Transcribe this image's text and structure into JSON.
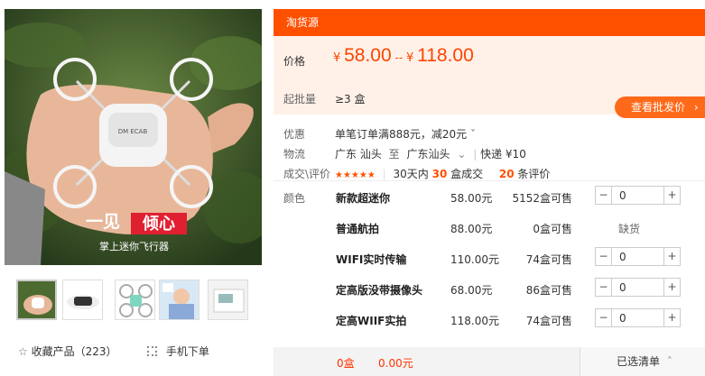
{
  "gallery": {
    "overlay_title_a": "一见",
    "overlay_title_b": "倾心",
    "overlay_subtitle": "掌上迷你飞行器",
    "drone_label": "DM ECAB"
  },
  "favorite": {
    "icon": "star-outline-icon",
    "label": "收藏产品（223）"
  },
  "mobile_order": {
    "icon": "qr-code-icon",
    "label": "手机下单"
  },
  "source_bar": {
    "label": "淘货源"
  },
  "price": {
    "label": "价格",
    "currency": "¥",
    "min": "58.00",
    "sep": "--",
    "max": "118.00"
  },
  "moq": {
    "label": "起批量",
    "value": "≥3 盒"
  },
  "wholesale_button": {
    "label": "查看批发价",
    "chevron": "›"
  },
  "promo": {
    "label": "优惠",
    "value": "单笔订单满888元，减20元",
    "chevron": "ˇ"
  },
  "logistics": {
    "label": "物流",
    "from": "广东 汕头",
    "to_word": "至",
    "to": "广东汕头",
    "chevron": "⌄",
    "separator": "|",
    "express": "快递 ¥10"
  },
  "reviews": {
    "label": "成交\\评价",
    "stars": "★★★★★",
    "rating": 4.5,
    "sales_prefix": "30天内",
    "sales_count": "30",
    "sales_suffix": "盒成交",
    "review_count": "20",
    "review_suffix": "条评价"
  },
  "sku_label": "颜色",
  "skus": [
    {
      "name": "新款超迷你",
      "price": "58.00元",
      "stock": "5152盒可售",
      "qty": "0"
    },
    {
      "name": "普通航拍",
      "price": "88.00元",
      "stock": "0盒可售",
      "qty": "",
      "status": "缺货"
    },
    {
      "name": "WIFI实时传输",
      "price": "110.00元",
      "stock": "74盒可售",
      "qty": "0"
    },
    {
      "name": "定高版没带摄像头",
      "price": "68.00元",
      "stock": "86盒可售",
      "qty": "0"
    },
    {
      "name": "定高WIIF实拍",
      "price": "118.00元",
      "stock": "74盒可售",
      "qty": "0"
    }
  ],
  "stepper": {
    "minus": "−",
    "plus": "+"
  },
  "summary": {
    "qty": "0盒",
    "total": "0.00元",
    "list_label": "已选清单",
    "list_chevron": "ˆ"
  },
  "colors": {
    "accent": "#ff5000",
    "price": "#ff4400",
    "price_bg": "#fff1e8"
  }
}
